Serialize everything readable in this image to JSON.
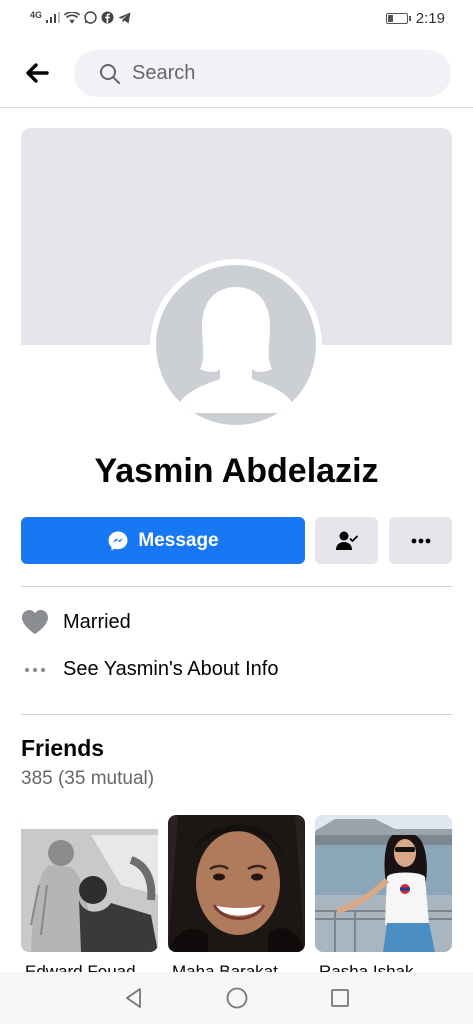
{
  "status_bar": {
    "network": "4G",
    "time": "2:19"
  },
  "header": {
    "search_placeholder": "Search"
  },
  "profile": {
    "name": "Yasmin Abdelaziz"
  },
  "actions": {
    "message_label": "Message"
  },
  "info": {
    "relationship": "Married",
    "about_link": "See Yasmin's About Info"
  },
  "friends": {
    "title": "Friends",
    "count": "385 (35 mutual)",
    "items": [
      {
        "name": "Edward Fouad"
      },
      {
        "name": "Maha Barakat"
      },
      {
        "name": "Rasha Ishak"
      }
    ]
  },
  "colors": {
    "brand": "#1877f2",
    "button_gray": "#e4e6eb",
    "cover": "#e4e6eb"
  }
}
